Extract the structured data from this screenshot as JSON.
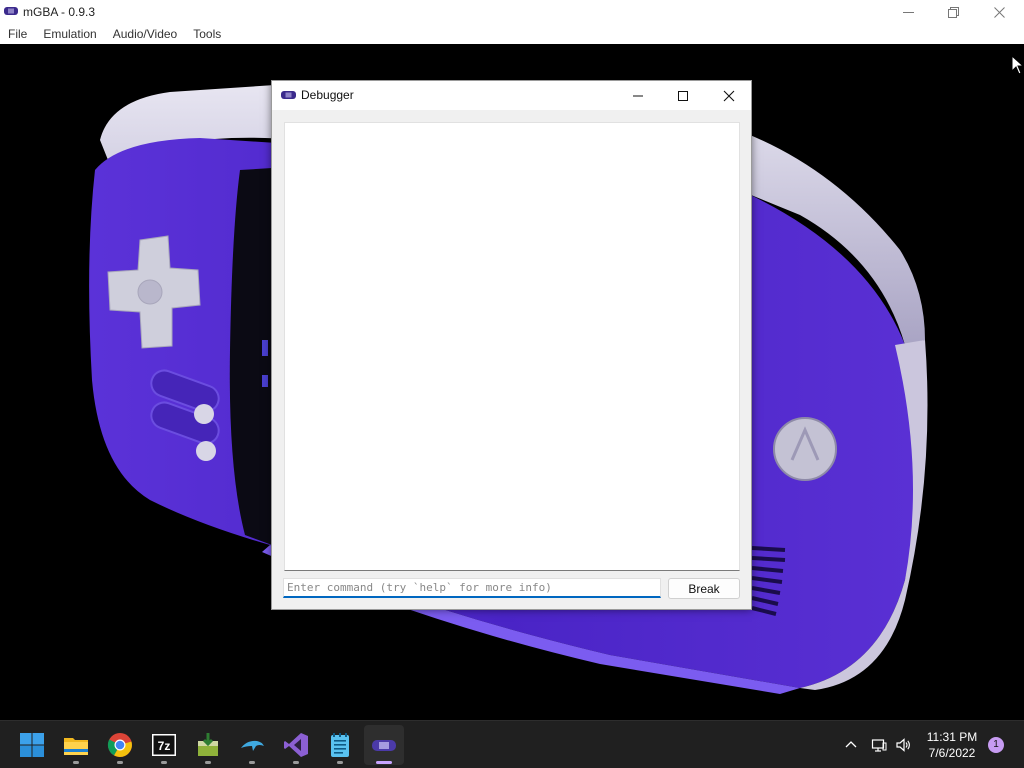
{
  "app": {
    "title": "mGBA - 0.9.3",
    "menu": [
      "File",
      "Emulation",
      "Audio/Video",
      "Tools"
    ]
  },
  "debugger": {
    "title": "Debugger",
    "log_text": "",
    "input_value": "",
    "input_placeholder": "Enter command (try `help` for more info)",
    "break_label": "Break"
  },
  "taskbar": {
    "apps": [
      {
        "name": "start-icon"
      },
      {
        "name": "file-explorer-icon"
      },
      {
        "name": "chrome-icon"
      },
      {
        "name": "7zip-icon",
        "label": "7z"
      },
      {
        "name": "installer-icon"
      },
      {
        "name": "dolphin-icon"
      },
      {
        "name": "visual-studio-icon"
      },
      {
        "name": "notepad-icon"
      },
      {
        "name": "mgba-icon"
      }
    ],
    "clock_time": "11:31 PM",
    "clock_date": "7/6/2022",
    "notification_count": "1"
  },
  "colors": {
    "gba_body": "#5a2fd6",
    "gba_trim": "#d9d6e8",
    "accent": "#0067c0",
    "taskbar": "#202020"
  }
}
